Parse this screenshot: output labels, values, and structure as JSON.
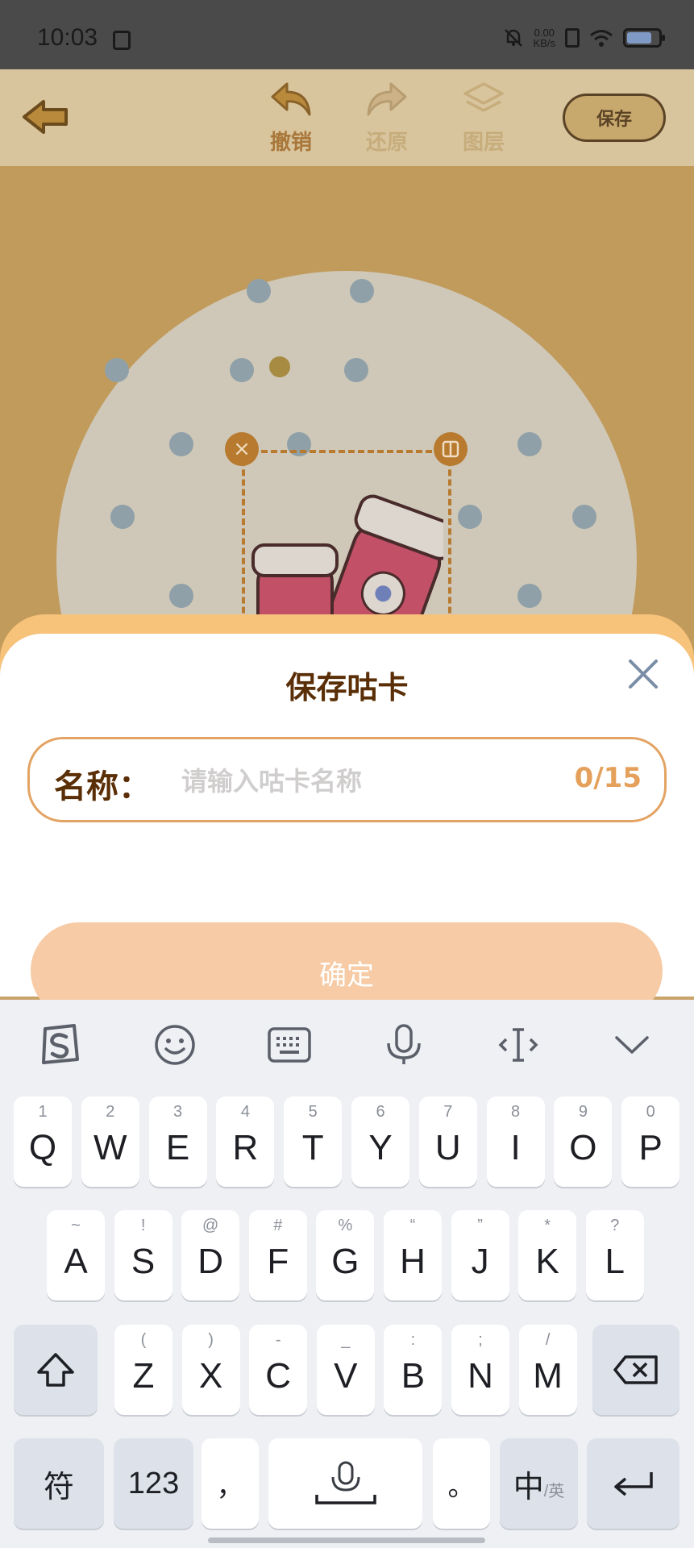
{
  "status_bar": {
    "time": "10:03",
    "net_speed_value": "0.00",
    "net_speed_unit": "KB/s"
  },
  "editor": {
    "toolbar": {
      "undo_label": "撤销",
      "redo_label": "还原",
      "layers_label": "图层",
      "save_label": "保存"
    }
  },
  "save_dialog": {
    "title": "保存咕卡",
    "name_label": "名称：",
    "name_value": "",
    "name_placeholder": "请输入咕卡名称",
    "char_count": "0/15",
    "confirm_label": "确定"
  },
  "keyboard": {
    "toolbar_icons": [
      "sogou-logo-icon",
      "emoji-icon",
      "keyboard-layout-icon",
      "microphone-icon",
      "cursor-icon",
      "collapse-keyboard-icon"
    ],
    "row1": [
      {
        "main": "Q",
        "sub": "1"
      },
      {
        "main": "W",
        "sub": "2"
      },
      {
        "main": "E",
        "sub": "3"
      },
      {
        "main": "R",
        "sub": "4"
      },
      {
        "main": "T",
        "sub": "5"
      },
      {
        "main": "Y",
        "sub": "6"
      },
      {
        "main": "U",
        "sub": "7"
      },
      {
        "main": "I",
        "sub": "8"
      },
      {
        "main": "O",
        "sub": "9"
      },
      {
        "main": "P",
        "sub": "0"
      }
    ],
    "row2": [
      {
        "main": "A",
        "sub": "~"
      },
      {
        "main": "S",
        "sub": "!"
      },
      {
        "main": "D",
        "sub": "@"
      },
      {
        "main": "F",
        "sub": "#"
      },
      {
        "main": "G",
        "sub": "%"
      },
      {
        "main": "H",
        "sub": "“"
      },
      {
        "main": "J",
        "sub": "”"
      },
      {
        "main": "K",
        "sub": "*"
      },
      {
        "main": "L",
        "sub": "?"
      }
    ],
    "row3": [
      {
        "main": "Z",
        "sub": "("
      },
      {
        "main": "X",
        "sub": ")"
      },
      {
        "main": "C",
        "sub": "-"
      },
      {
        "main": "V",
        "sub": "_"
      },
      {
        "main": "B",
        "sub": ":"
      },
      {
        "main": "N",
        "sub": ";"
      },
      {
        "main": "M",
        "sub": "/"
      }
    ],
    "symbol_key": "符",
    "numbers_key": "123",
    "comma_key": "，",
    "period_key": "。",
    "lang_key_main": "中",
    "lang_key_sub": "/英"
  }
}
